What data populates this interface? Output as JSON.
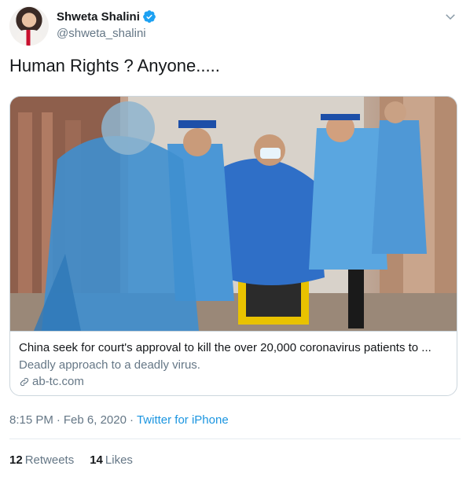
{
  "header": {
    "display_name": "Shweta Shalini",
    "handle": "@shweta_shalini"
  },
  "tweet": {
    "text": "Human Rights ? Anyone....."
  },
  "card": {
    "title": "China seek for court's approval to kill the over 20,000 coronavirus patients to ...",
    "description": "Deadly approach to a deadly virus.",
    "domain": "ab-tc.com"
  },
  "meta": {
    "time": "8:15 PM",
    "separator1": "·",
    "date": "Feb 6, 2020",
    "separator2": "·",
    "source": "Twitter for iPhone"
  },
  "stats": {
    "retweets_count": "12",
    "retweets_label": "Retweets",
    "likes_count": "14",
    "likes_label": "Likes"
  },
  "colors": {
    "accent": "#1b95e0",
    "secondary_text": "#657786",
    "verified": "#1da1f2"
  }
}
